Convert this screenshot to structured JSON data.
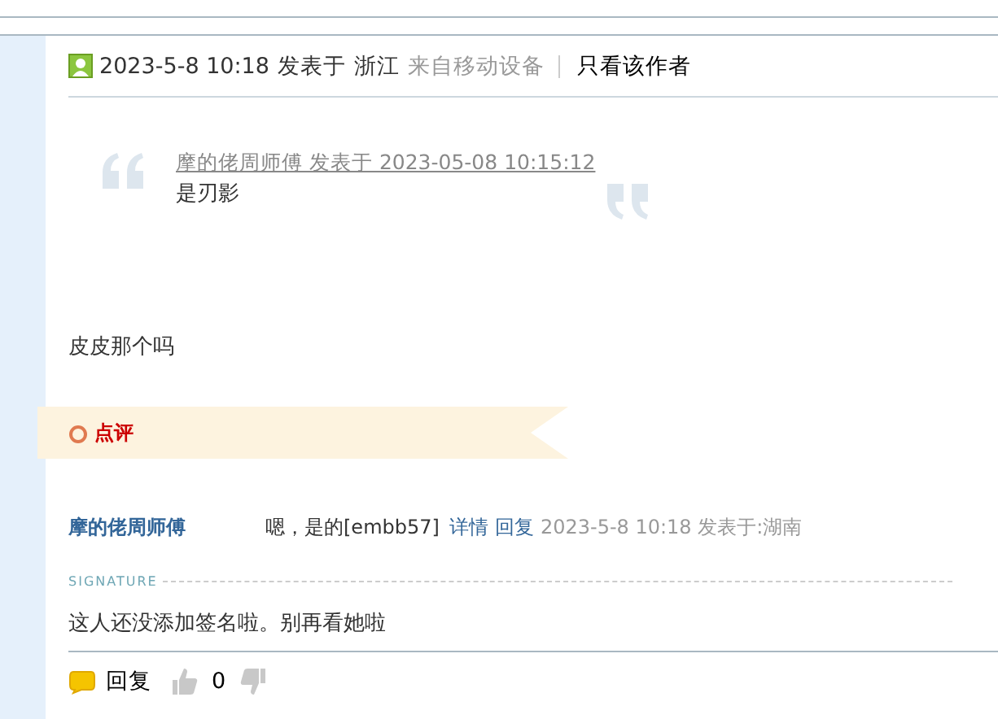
{
  "post_header": {
    "date": "2023-5-8 10:18",
    "posted_label": "发表于",
    "location": "浙江",
    "device": "来自移动设备",
    "author_only": "只看该作者"
  },
  "quote": {
    "author_line": "摩的佬周师傅 发表于 2023-05-08 10:15:12",
    "text": "是刃影"
  },
  "body": "皮皮那个吗",
  "comment_panel": {
    "title": "点评",
    "comments": [
      {
        "author": "摩的佬周师傅",
        "text": "嗯，是的[embb57]",
        "detail_link": "详情",
        "reply_link": "回复",
        "meta": "2023-5-8 10:18 发表于:湖南"
      }
    ]
  },
  "signature": {
    "label": "SIGNATURE",
    "text": "这人还没添加签名啦。别再看她啦"
  },
  "footer": {
    "reply": "回复",
    "like_count": "0"
  }
}
